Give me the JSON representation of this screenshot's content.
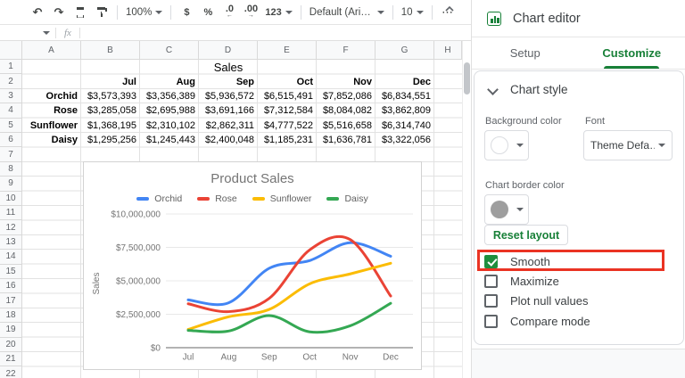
{
  "toolbar": {
    "zoom": "100%",
    "currency": "$",
    "percent": "%",
    "decrease_decimal": ".0",
    "increase_decimal": ".00",
    "number_format": "123",
    "font": "Default (Ari…",
    "font_size": "10",
    "more": "⋯"
  },
  "formula_bar": {
    "fx": "fx"
  },
  "sheet": {
    "columns": [
      "A",
      "B",
      "C",
      "D",
      "E",
      "F",
      "G",
      "H"
    ],
    "row_count": 22,
    "title_cell": "Sales"
  },
  "chart_data": {
    "type": "line",
    "title": "Product Sales",
    "x": [
      "Jul",
      "Aug",
      "Sep",
      "Oct",
      "Nov",
      "Dec"
    ],
    "series": [
      {
        "name": "Orchid",
        "color": "#4285f4",
        "values": [
          3573393,
          3356389,
          5936572,
          6515491,
          7852086,
          6834551
        ]
      },
      {
        "name": "Rose",
        "color": "#ea4335",
        "values": [
          3285058,
          2695988,
          3691166,
          7312584,
          8084082,
          3862809
        ]
      },
      {
        "name": "Sunflower",
        "color": "#fbbc04",
        "values": [
          1368195,
          2310102,
          2862311,
          4777522,
          5516658,
          6314740
        ]
      },
      {
        "name": "Daisy",
        "color": "#34a853",
        "values": [
          1295256,
          1245443,
          2400048,
          1185231,
          1636781,
          3322056
        ]
      }
    ],
    "ylabel": "Sales",
    "ylim": [
      0,
      10000000
    ],
    "yticks": [
      0,
      2500000,
      5000000,
      7500000,
      10000000
    ],
    "ytick_labels": [
      "$0",
      "$2,500,000",
      "$5,000,000",
      "$7,500,000",
      "$10,000,000"
    ],
    "smooth": true,
    "grid": true,
    "legend_position": "top"
  },
  "panel": {
    "title": "Chart editor",
    "tabs": {
      "setup": "Setup",
      "customize": "Customize"
    },
    "section_title": "Chart style",
    "background_color_label": "Background color",
    "font_label": "Font",
    "font_value": "Theme Defa…",
    "border_color_label": "Chart border color",
    "reset_button": "Reset layout",
    "checkboxes": [
      {
        "label": "Smooth",
        "checked": true,
        "highlighted": true
      },
      {
        "label": "Maximize",
        "checked": false,
        "highlighted": false
      },
      {
        "label": "Plot null values",
        "checked": false,
        "highlighted": false
      },
      {
        "label": "Compare mode",
        "checked": false,
        "highlighted": false
      }
    ]
  },
  "colors": {
    "accent_green": "#188038",
    "checkbox_green": "#1e8e3e",
    "highlight_red": "#ea3323",
    "background_swatch": "#ffffff",
    "border_swatch": "#9e9e9e"
  }
}
